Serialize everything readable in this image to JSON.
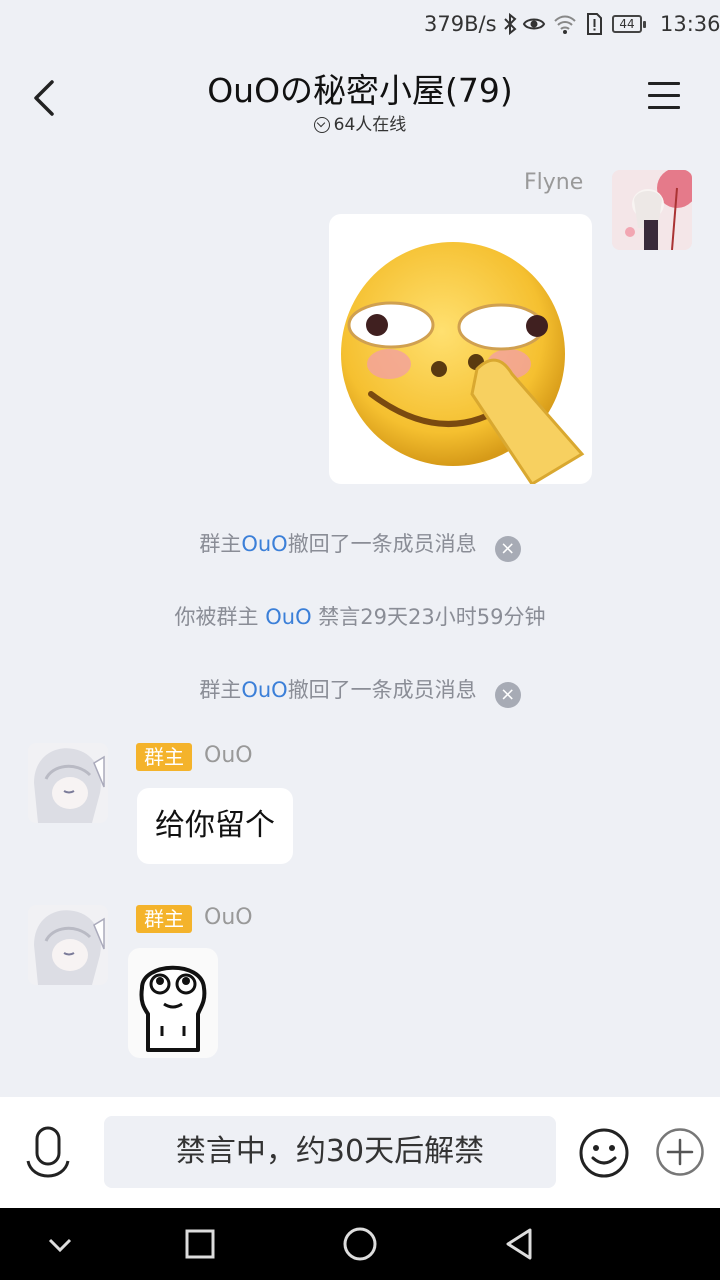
{
  "status_bar": {
    "net_speed": "379B/s",
    "battery": "44",
    "time": "13:36",
    "icons": [
      "bluetooth-icon",
      "eye-icon",
      "wifi-icon",
      "sim-alert-icon",
      "battery-icon"
    ]
  },
  "header": {
    "title": "OuOの秘密小屋(79)",
    "online": "64人在线",
    "icons": [
      "back-arrow-icon",
      "chevron-down-icon",
      "menu-icon"
    ]
  },
  "messages": {
    "m1": {
      "sender": "Flyne"
    },
    "sys1": {
      "prefix": "群主",
      "name": "OuO",
      "suffix": "撤回了一条成员消息"
    },
    "sys2": {
      "prefix": "你被群主 ",
      "name": "OuO",
      "suffix": " 禁言29天23小时59分钟"
    },
    "sys3": {
      "prefix": "群主",
      "name": "OuO",
      "suffix": "撤回了一条成员消息"
    },
    "m2": {
      "badge": "群主",
      "sender": "OuO",
      "text": "给你留个"
    },
    "m3": {
      "badge": "群主",
      "sender": "OuO"
    }
  },
  "input_bar": {
    "muted_text": "禁言中，约30天后解禁",
    "icons": [
      "microphone-icon",
      "smiley-icon",
      "plus-icon"
    ]
  },
  "nav_bar": {
    "icons": [
      "nav-collapse-icon",
      "nav-recents-icon",
      "nav-home-icon",
      "nav-back-icon"
    ]
  },
  "colors": {
    "background": "#eef0f5",
    "highlight": "#3b7fd8",
    "badge": "#f4b32b"
  }
}
